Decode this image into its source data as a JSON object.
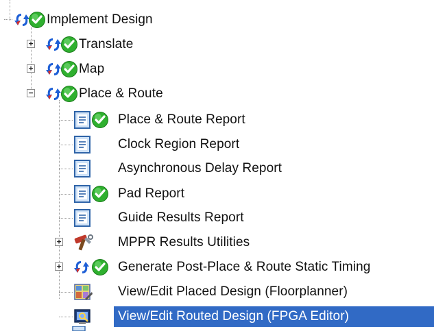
{
  "tree": {
    "items": [
      {
        "label": "Implement Design",
        "icons": [
          "process-refresh-icon",
          "status-ok-icon"
        ],
        "expander": "none"
      },
      {
        "label": "Translate",
        "icons": [
          "process-refresh-icon",
          "status-ok-icon"
        ],
        "expander": "plus"
      },
      {
        "label": "Map",
        "icons": [
          "process-refresh-icon",
          "status-ok-icon"
        ],
        "expander": "plus"
      },
      {
        "label": "Place & Route",
        "icons": [
          "process-refresh-icon",
          "status-ok-icon"
        ],
        "expander": "minus"
      },
      {
        "label": "Place & Route Report",
        "icons": [
          "report-document-icon",
          "status-ok-icon"
        ],
        "expander": "none"
      },
      {
        "label": "Clock Region Report",
        "icons": [
          "report-document-icon"
        ],
        "expander": "none"
      },
      {
        "label": "Asynchronous Delay Report",
        "icons": [
          "report-document-icon"
        ],
        "expander": "none"
      },
      {
        "label": "Pad Report",
        "icons": [
          "report-document-icon",
          "status-ok-icon"
        ],
        "expander": "none"
      },
      {
        "label": "Guide Results Report",
        "icons": [
          "report-document-icon"
        ],
        "expander": "none"
      },
      {
        "label": "MPPR Results Utilities",
        "icons": [
          "tools-icon"
        ],
        "expander": "plus"
      },
      {
        "label": "Generate Post-Place & Route Static Timing",
        "icons": [
          "process-refresh-icon",
          "status-ok-icon"
        ],
        "expander": "plus"
      },
      {
        "label": "View/Edit Placed Design (Floorplanner)",
        "icons": [
          "floorplanner-icon"
        ],
        "expander": "none"
      },
      {
        "label": "View/Edit Routed Design (FPGA Editor)",
        "icons": [
          "fpga-editor-icon"
        ],
        "expander": "none",
        "selected": true
      }
    ],
    "expander_symbols": {
      "plus": "+",
      "minus": "−"
    },
    "colors": {
      "selection": "#316ac5",
      "check_green": "#2fb02f",
      "refresh_blue": "#1e5fd6",
      "refresh_red": "#d8302a"
    }
  }
}
